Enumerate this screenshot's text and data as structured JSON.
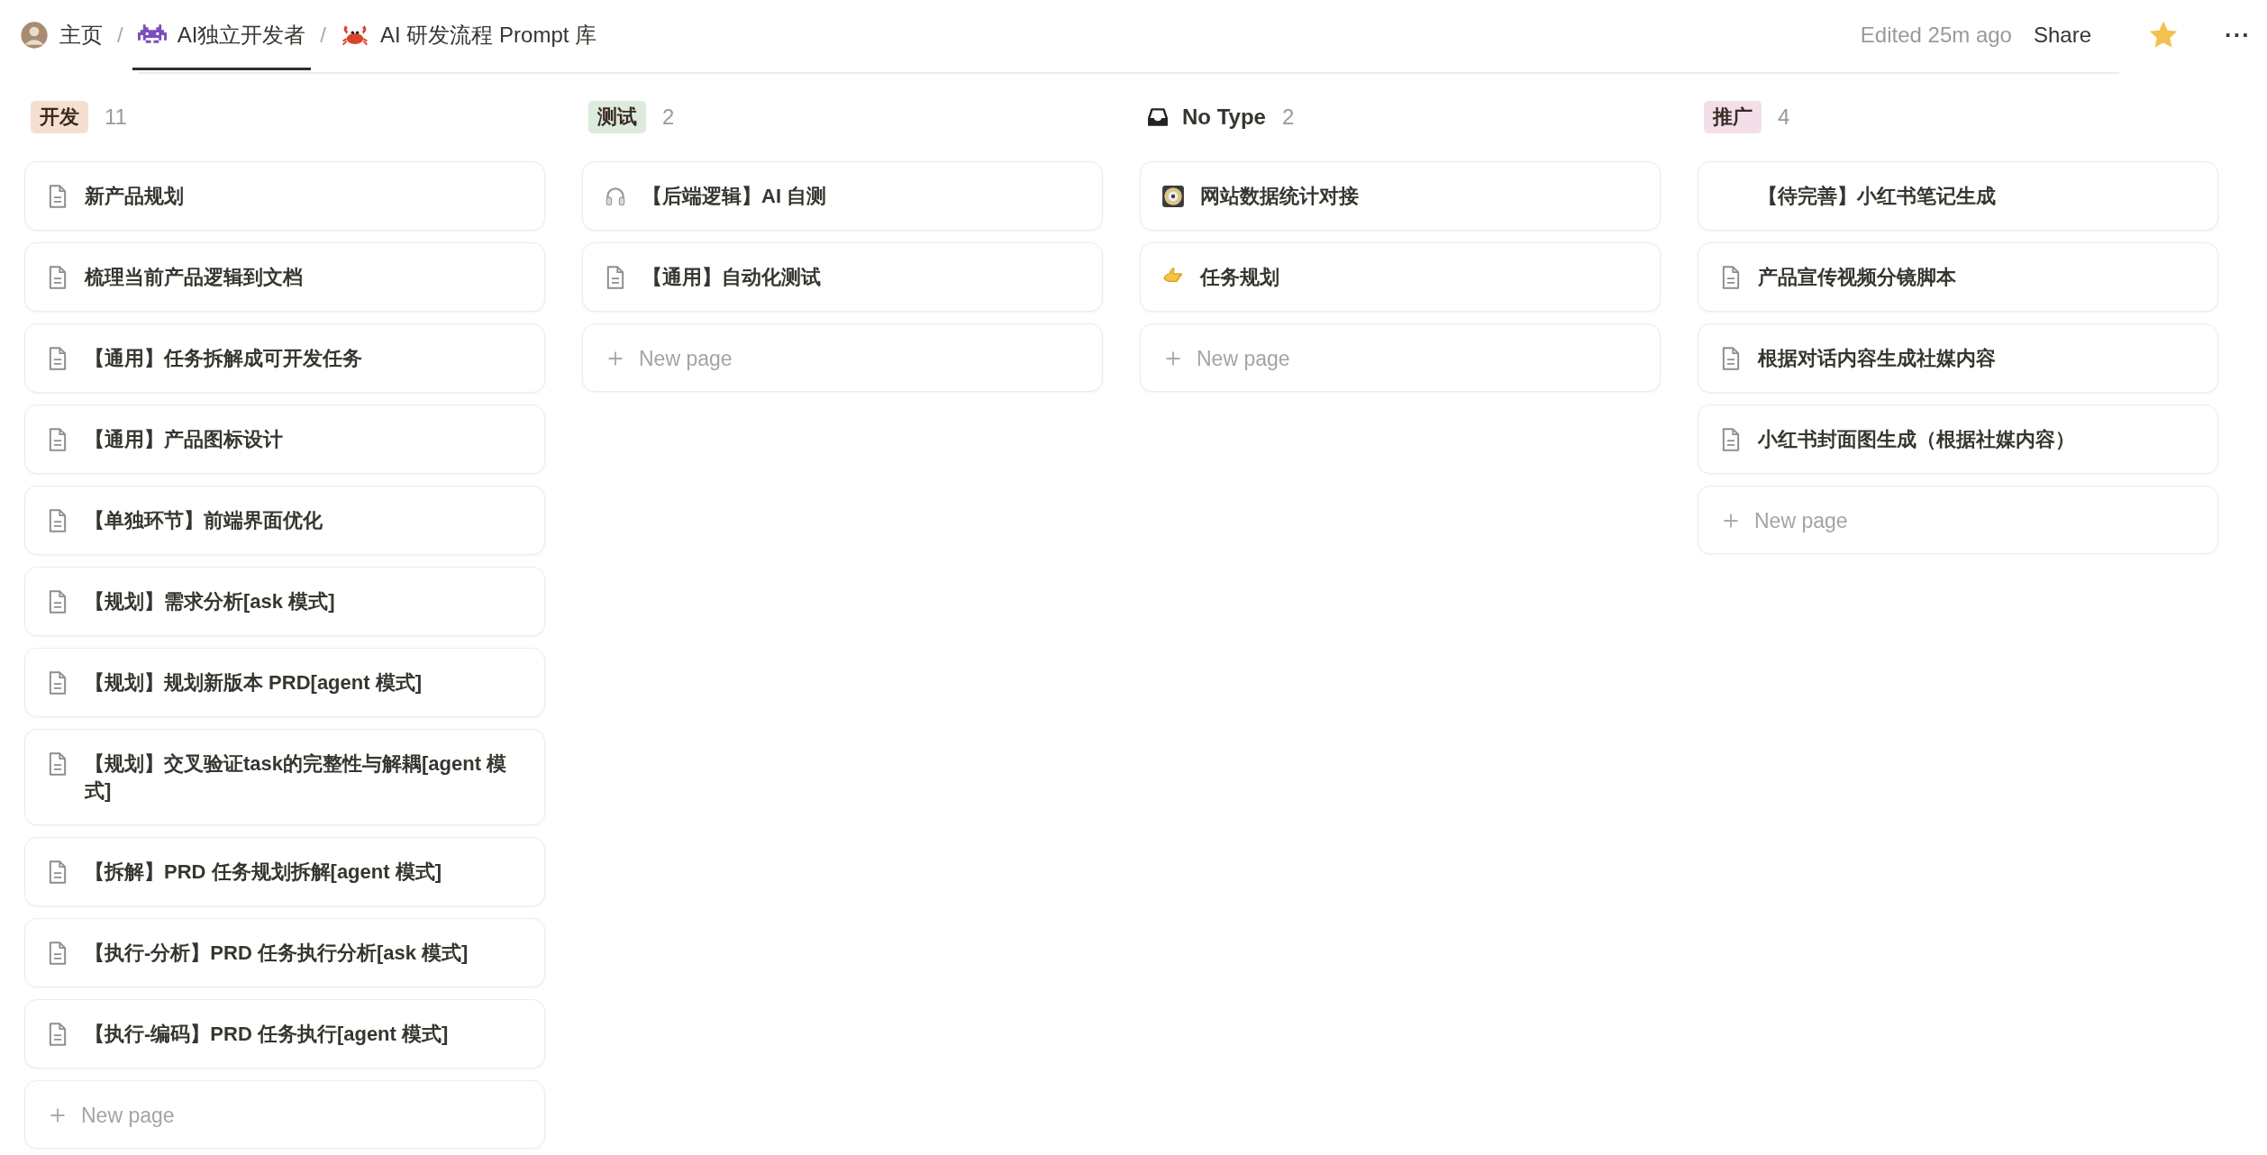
{
  "breadcrumbs": [
    {
      "label": "主页",
      "kind": "avatar",
      "selected": false
    },
    {
      "label": "AI独立开发者",
      "kind": "alien",
      "selected": true
    },
    {
      "label": "AI 研发流程 Prompt 库",
      "kind": "crab",
      "selected": false
    }
  ],
  "separator": "/",
  "edited": "Edited 25m ago",
  "share": "Share",
  "favorite": true,
  "more": "···",
  "columns": [
    {
      "kind": "tag",
      "title": "开发",
      "color": "#f5dfd1",
      "count": "11",
      "new_page": "New page",
      "cards": [
        {
          "kind": "doc",
          "title": "新产品规划"
        },
        {
          "kind": "doc",
          "title": "梳理当前产品逻辑到文档"
        },
        {
          "kind": "doc",
          "title": "【通用】任务拆解成可开发任务"
        },
        {
          "kind": "doc",
          "title": "【通用】产品图标设计"
        },
        {
          "kind": "doc",
          "title": "【单独环节】前端界面优化"
        },
        {
          "kind": "doc",
          "title": "【规划】需求分析[ask 模式]"
        },
        {
          "kind": "doc",
          "title": "【规划】规划新版本 PRD[agent 模式]"
        },
        {
          "kind": "doc",
          "title": "【规划】交叉验证task的完整性与解耦[agent 模式]"
        },
        {
          "kind": "doc",
          "title": "【拆解】PRD 任务规划拆解[agent 模式]"
        },
        {
          "kind": "doc",
          "title": "【执行-分析】PRD 任务执行分析[ask 模式]"
        },
        {
          "kind": "doc",
          "title": "【执行-编码】PRD 任务执行[agent 模式]"
        }
      ]
    },
    {
      "kind": "tag",
      "title": "测试",
      "color": "#dcebdd",
      "count": "2",
      "new_page": "New page",
      "cards": [
        {
          "kind": "headphones",
          "title": "【后端逻辑】AI 自测"
        },
        {
          "kind": "doc",
          "title": "【通用】自动化测试"
        }
      ]
    },
    {
      "kind": "inbox",
      "title": "No Type",
      "count": "2",
      "new_page": "New page",
      "cards": [
        {
          "kind": "disc",
          "title": "网站数据统计对接"
        },
        {
          "kind": "hand",
          "title": "任务规划"
        }
      ]
    },
    {
      "kind": "tag",
      "title": "推广",
      "color": "#f2dfe9",
      "count": "4",
      "new_page": "New page",
      "cards": [
        {
          "kind": "none",
          "title": "【待完善】小红书笔记生成"
        },
        {
          "kind": "doc",
          "title": "产品宣传视频分镜脚本"
        },
        {
          "kind": "doc",
          "title": "根据对话内容生成社媒内容"
        },
        {
          "kind": "doc",
          "title": "小红书封面图生成（根据社媒内容）"
        }
      ]
    }
  ]
}
